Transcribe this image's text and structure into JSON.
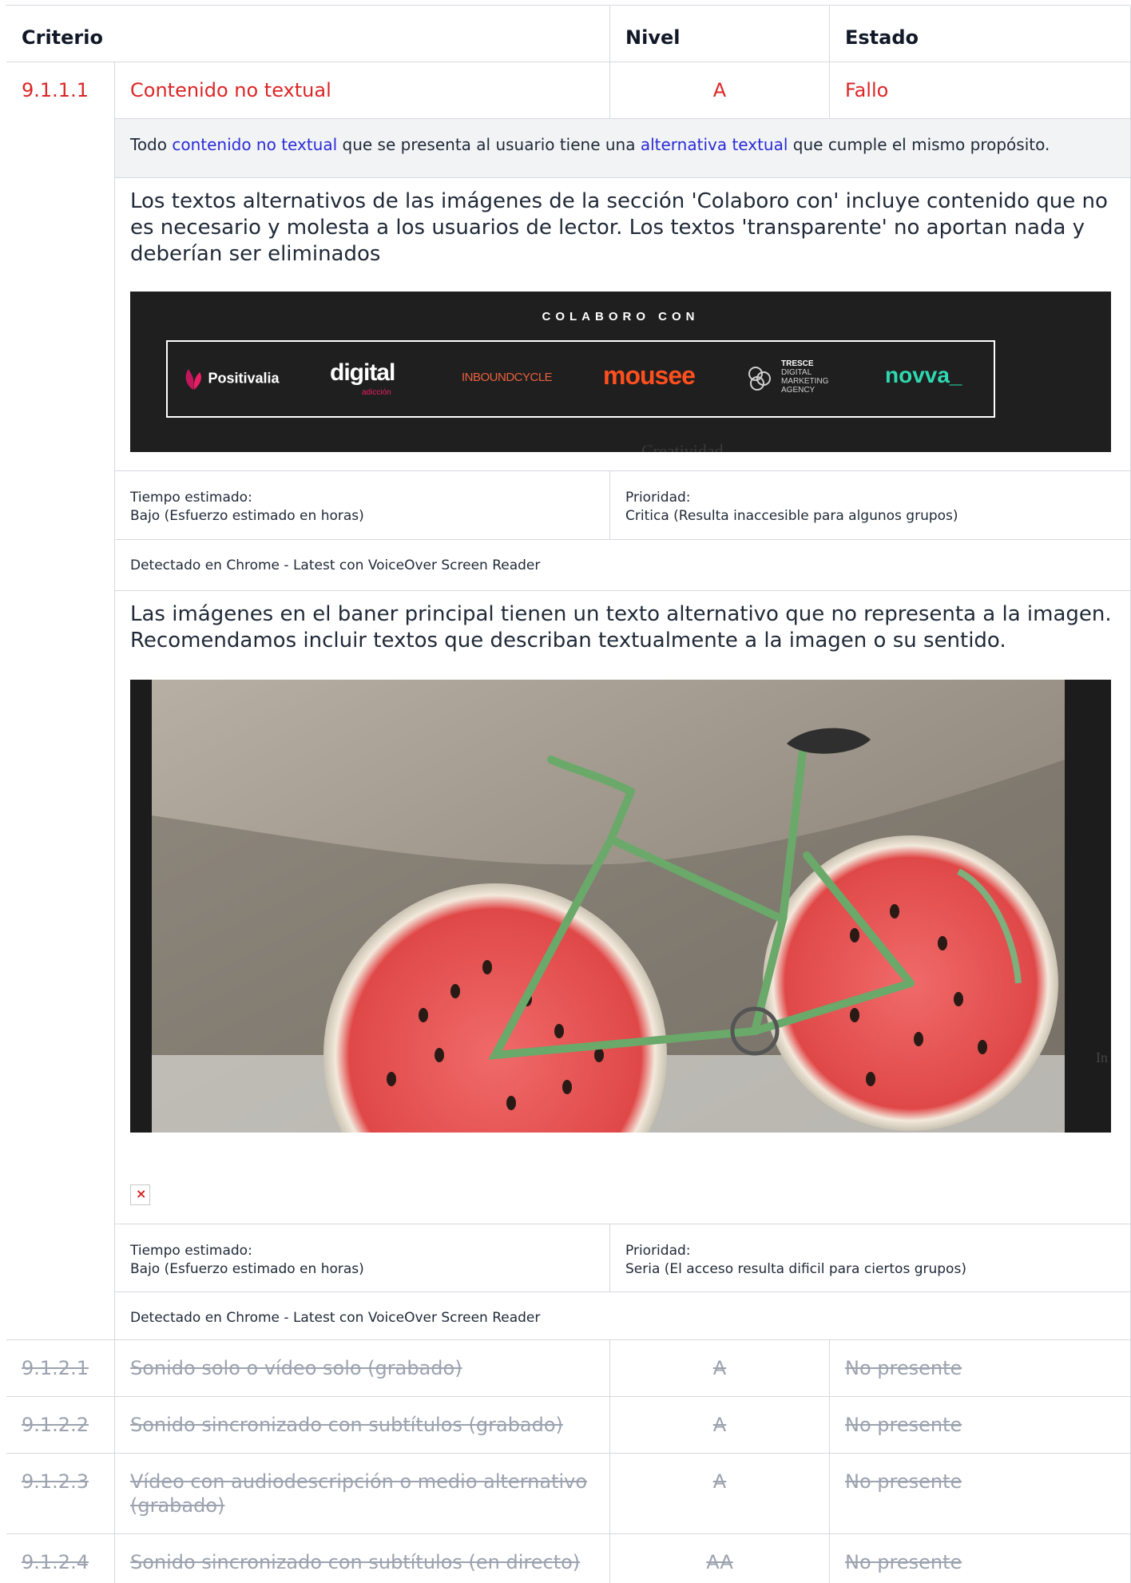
{
  "header": {
    "criterio": "Criterio",
    "nivel": "Nivel",
    "estado": "Estado"
  },
  "main_criterion": {
    "id": "9.1.1.1",
    "name": "Contenido no textual",
    "level": "A",
    "state": "Fallo",
    "description": {
      "prefix": "Todo ",
      "link1": "contenido no textual",
      "middle": " que se presenta al usuario tiene una ",
      "link2": "alternativa textual",
      "suffix": " que cumple el mismo propósito."
    }
  },
  "issues": [
    {
      "text": "Los textos alternativos de las imágenes de la sección 'Colaboro con' incluye contenido que no es necesario y molesta a los usuarios de lector. Los textos 'transparente' no aportan nada y deberían ser eliminados",
      "time_label": "Tiempo estimado:",
      "time_value": "Bajo (Esfuerzo estimado en horas)",
      "priority_label": "Prioridad:",
      "priority_value": "Critica (Resulta inaccesible para algunos grupos)",
      "detected": "Detectado en Chrome - Latest con VoiceOver Screen Reader"
    },
    {
      "text": "Las imágenes en el baner principal tienen un texto alternativo que no representa a la imagen. Recomendamos incluir textos que describan textualmente a la imagen o su sentido.",
      "time_label": "Tiempo estimado:",
      "time_value": "Bajo (Esfuerzo estimado en horas)",
      "priority_label": "Prioridad:",
      "priority_value": "Seria (El acceso resulta dificil para ciertos grupos)",
      "detected": "Detectado en Chrome - Latest con VoiceOver Screen Reader"
    }
  ],
  "banner": {
    "title": "COLABORO CON",
    "logos": [
      "Positivalia",
      "digital",
      "adicción",
      "INBOUNDCYCLE",
      "mousee",
      "TRESCE",
      "DIGITAL",
      "MARKETING",
      "AGENCY",
      "novva_"
    ],
    "ghost_text": "Creatividad"
  },
  "photo": {
    "ghost_text": "In"
  },
  "broken_image_glyph": "×",
  "other_criteria": [
    {
      "id": "9.1.2.1",
      "name": "Sonido solo o vídeo solo (grabado)",
      "level": "A",
      "state": "No presente"
    },
    {
      "id": "9.1.2.2",
      "name": "Sonido sincronizado con subtítulos (grabado)",
      "level": "A",
      "state": "No presente"
    },
    {
      "id": "9.1.2.3",
      "name": "Vídeo con audiodescripción o medio alternativo (grabado)",
      "level": "A",
      "state": "No presente"
    },
    {
      "id": "9.1.2.4",
      "name": "Sonido sincronizado con subtítulos (en directo)",
      "level": "AA",
      "state": "No presente"
    }
  ],
  "colors": {
    "fail": "#dc2626",
    "link": "#2b2bd6",
    "muted": "#9ca3af",
    "border": "#d6d9de",
    "desc_bg": "#f1f3f5"
  }
}
